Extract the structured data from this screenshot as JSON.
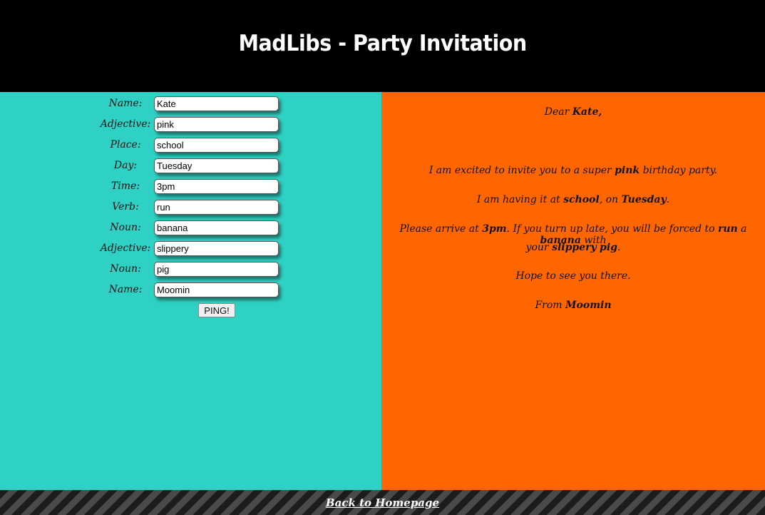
{
  "header": {
    "title": "MadLibs - Party Invitation"
  },
  "form": {
    "fields": [
      {
        "label": "Name:",
        "value": "Kate"
      },
      {
        "label": "Adjective:",
        "value": "pink"
      },
      {
        "label": "Place:",
        "value": "school"
      },
      {
        "label": "Day:",
        "value": "Tuesday"
      },
      {
        "label": "Time:",
        "value": "3pm"
      },
      {
        "label": "Verb:",
        "value": "run"
      },
      {
        "label": "Noun:",
        "value": "banana"
      },
      {
        "label": "Adjective:",
        "value": "slippery"
      },
      {
        "label": "Noun:",
        "value": "pig"
      },
      {
        "label": "Name:",
        "value": "Moomin"
      }
    ],
    "submit_label": "PING!"
  },
  "letter": {
    "greeting_prefix": "Dear ",
    "greeting_name": "Kate,",
    "l1_a": "I am excited to invite you to a super ",
    "l1_adj": "pink",
    "l1_b": " birthday party.",
    "l2_a": "I am having it at ",
    "l2_place": "school",
    "l2_b": ", on ",
    "l2_day": "Tuesday",
    "l2_c": ".",
    "l3_a": "Please arrive at ",
    "l3_time": "3pm",
    "l3_b": ". If you turn up late, you will be forced to ",
    "l3_verb": "run",
    "l3_c": " a ",
    "l3_noun": "banana",
    "l3_d": " with",
    "l4_a": "your ",
    "l4_adj": "slippery",
    "l4_b": " ",
    "l4_noun": "pig",
    "l4_c": ".",
    "l5": "Hope to see you there.",
    "l6_a": "From ",
    "l6_name": "Moomin"
  },
  "footer": {
    "link": "Back to Homepage"
  }
}
